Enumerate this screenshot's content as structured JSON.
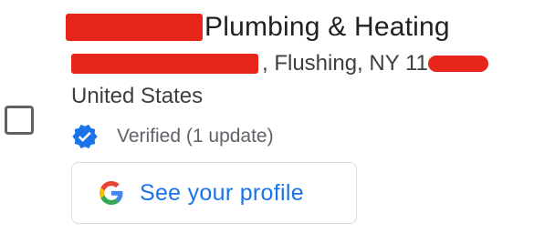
{
  "listing": {
    "business_name_suffix": "Plumbing & Heating",
    "address_visible": ", Flushing, NY 11",
    "country": "United States",
    "verification": {
      "status_text": "Verified (1 update)",
      "icon": "verified-badge-icon"
    },
    "profile_button": {
      "label": "See your profile",
      "icon": "google-g-icon"
    }
  },
  "colors": {
    "redaction": "#e8251b",
    "link_blue": "#1a73e8",
    "verified_blue": "#1a73e8"
  }
}
